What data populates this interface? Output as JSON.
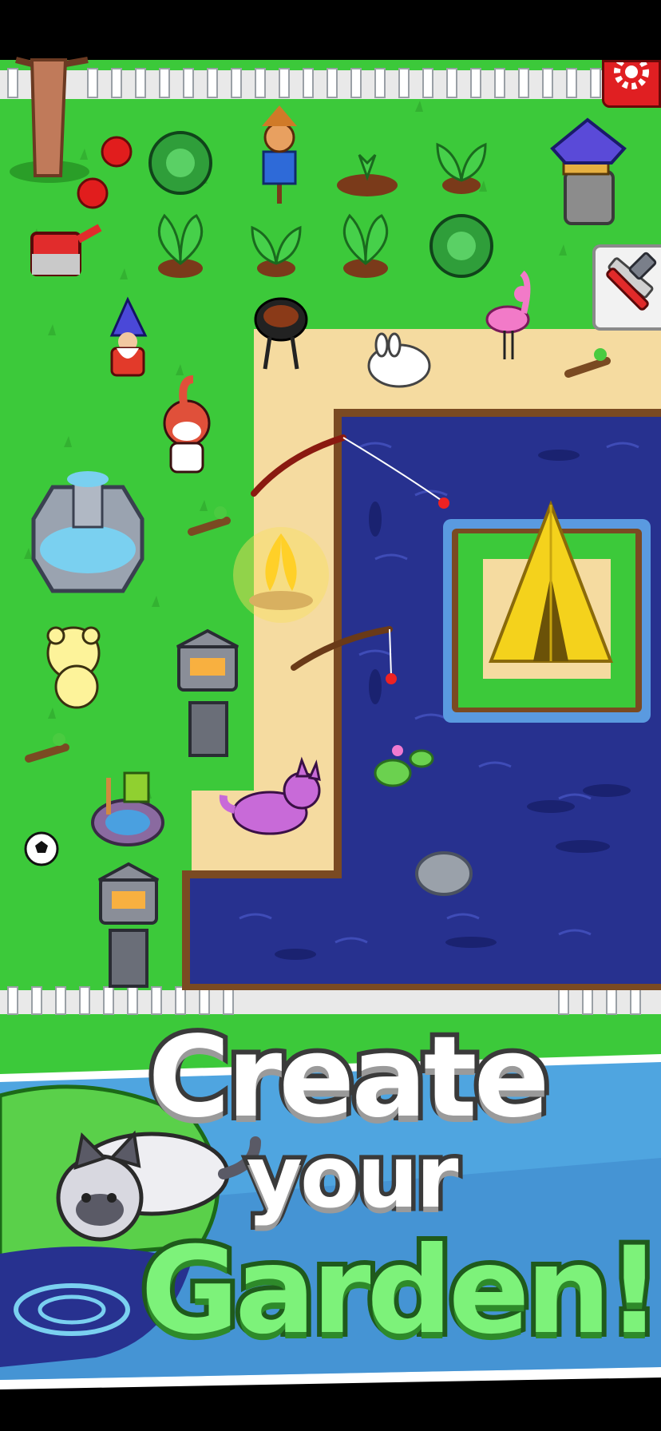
{
  "screen": {
    "title": "Garden game screenshot"
  },
  "hud": {
    "settings_button_icon": "gear-icon",
    "build_button_icon": "hammer-ruler-icon"
  },
  "banner": {
    "line1": "Create",
    "line2": "your",
    "line3": "Garden!"
  },
  "colors": {
    "grass": "#3cc93a",
    "sand": "#f5dba0",
    "water": "#27318f",
    "fence": "#f2f2f2",
    "settings_red": "#e01f22",
    "banner_sky": "#4fa5e0"
  },
  "scene_items": [
    "tree",
    "apple",
    "apple",
    "cabbage",
    "scarecrow",
    "sprout-mound",
    "sprout",
    "watering-can",
    "carrot",
    "radish",
    "carrot",
    "cabbage",
    "bird-house",
    "gnome",
    "bbq-grill",
    "flamingo",
    "bunny",
    "red-panda",
    "fishing-rod",
    "fountain",
    "twig",
    "campfire",
    "tent",
    "fishing-rod",
    "yellow-bear",
    "stone-lantern",
    "lily-pad",
    "twig",
    "purple-wolf",
    "water-pump",
    "soccer-ball",
    "stone-lantern",
    "rock",
    "cat"
  ]
}
